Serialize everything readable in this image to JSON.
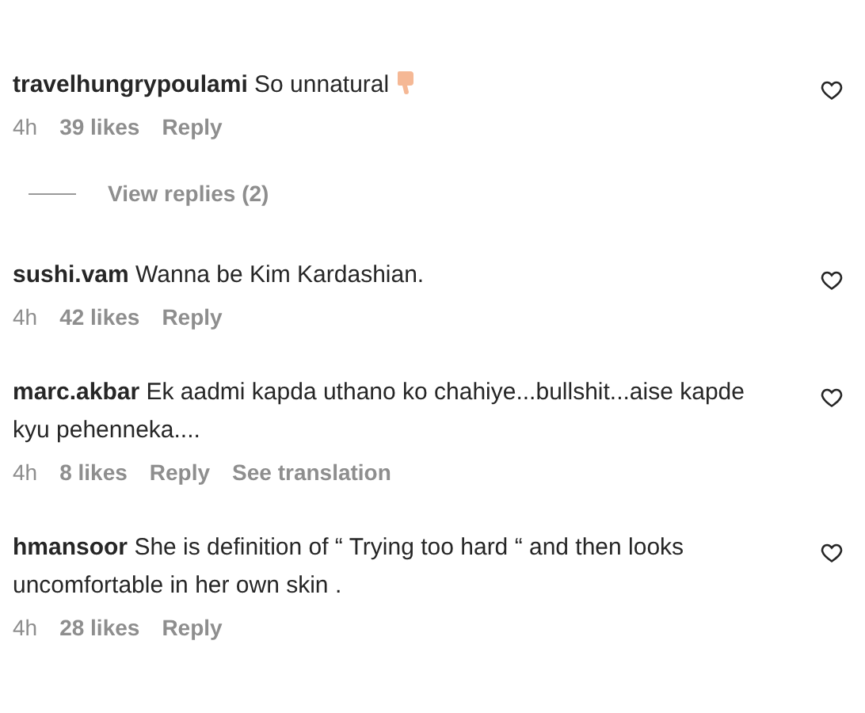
{
  "items": [
    {
      "kind": "comment",
      "username": "travelhungrypoulami",
      "text": "So unnatural",
      "reaction_icon": true,
      "time": "4h",
      "likes": "39 likes",
      "actions": [
        "Reply"
      ]
    },
    {
      "kind": "replies",
      "label": "View replies (2)"
    },
    {
      "kind": "comment",
      "username": "sushi.vam",
      "text": "Wanna be Kim Kardashian.",
      "reaction_icon": false,
      "time": "4h",
      "likes": "42 likes",
      "actions": [
        "Reply"
      ]
    },
    {
      "kind": "comment",
      "username": "marc.akbar",
      "text": "Ek aadmi kapda uthano ko chahiye...bullshit...aise kapde kyu pehenneka....",
      "reaction_icon": false,
      "time": "4h",
      "likes": "8 likes",
      "actions": [
        "Reply",
        "See translation"
      ]
    },
    {
      "kind": "comment",
      "username": "hmansoor",
      "text": "She is definition of “ Trying too hard “ and then looks uncomfortable in her own skin .",
      "reaction_icon": false,
      "time": "4h",
      "likes": "28 likes",
      "actions": [
        "Reply"
      ]
    }
  ]
}
